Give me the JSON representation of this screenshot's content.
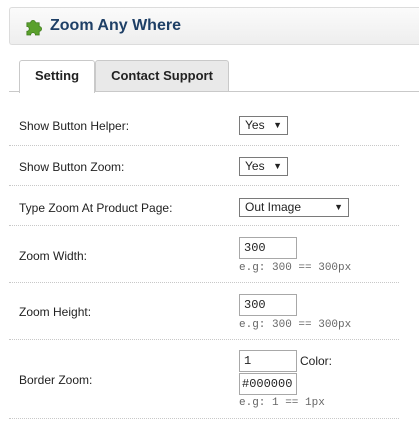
{
  "header": {
    "title": "Zoom Any Where",
    "icon": "puzzle-piece-icon",
    "icon_color": "#5aa02c"
  },
  "tabs": [
    {
      "label": "Setting",
      "active": true
    },
    {
      "label": "Contact Support",
      "active": false
    }
  ],
  "fields": {
    "show_button_helper": {
      "label": "Show Button Helper:",
      "value": "Yes"
    },
    "show_button_zoom": {
      "label": "Show Button Zoom:",
      "value": "Yes"
    },
    "type_zoom": {
      "label": "Type Zoom At Product Page:",
      "value": "Out Image"
    },
    "zoom_width": {
      "label": "Zoom Width:",
      "value": "300",
      "hint": "e.g: 300 == 300px"
    },
    "zoom_height": {
      "label": "Zoom Height:",
      "value": "300",
      "hint": "e.g: 300 == 300px"
    },
    "border_zoom": {
      "label": "Border Zoom:",
      "size_value": "1",
      "color_label": "Color:",
      "color_value": "#000000",
      "hint": "e.g: 1 == 1px"
    }
  },
  "dropdown_arrow": "▼"
}
